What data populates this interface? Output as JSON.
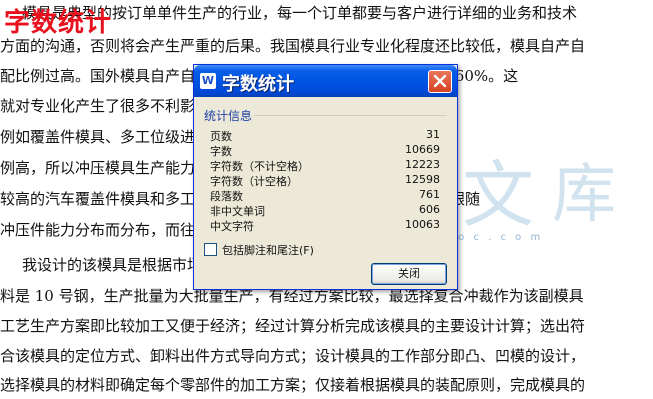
{
  "document": {
    "heading_overlay": "字数统计",
    "lines": [
      "模具是典型的按订单单件生产的行业，每一个订单都要与客户进行详细的业务和技术",
      "方面的沟通，否则将会产生严重的后果。我国模具行业专业化程度还比较低，模具自产自",
      "配比例过高。国外模具自产自配比例较低，一般模具自产自配比例为 60%。这",
      "就对专业化产生了很多不利影响，其专业化程度较高，",
      "例如覆盖件模具、多工位级进模具，专业化程度就较低。由于自配比",
      "例高，所以冲压模具生产能力分布，与冲压件分布。但是专业化程度",
      "较高的汽车覆盖件模具和多工位级进模具，其模具的分布有不少并不跟随",
      "冲压件能力分布而分布，而往往…",
      "我设计的该模具是根据市场需求…，可知，该零件所用的材",
      "料是 10 号钢，生产批量为大批量生产，有经过方案比较，最选择复合冲裁作为该副模具",
      "工艺生产方案即比较加工又便于经济；经过计算分析完成该模具的主要设计计算；选出符",
      "合该模具的定位方式、卸料出件方式导向方式；设计模具的工作部分即凸、凹模的设计，",
      "选择模具的材料即确定每个零部件的加工方案；仅接着根据模具的装配原则，完成模具的"
    ],
    "watermark_text": "文",
    "watermark_url": "w w w . w e n d o c . c o m"
  },
  "dialog": {
    "title": "字数统计",
    "group_title": "统计信息",
    "stats": [
      {
        "label": "页数",
        "value": "31"
      },
      {
        "label": "字数",
        "value": "10669"
      },
      {
        "label": "字符数（不计空格）",
        "value": "12223"
      },
      {
        "label": "字符数（计空格）",
        "value": "12598"
      },
      {
        "label": "段落数",
        "value": "761"
      },
      {
        "label": "非中文单词",
        "value": "606"
      },
      {
        "label": "中文字符",
        "value": "10063"
      }
    ],
    "checkbox_label": "包括脚注和尾注(F)",
    "checkbox_checked": false,
    "close_button": "关闭"
  }
}
